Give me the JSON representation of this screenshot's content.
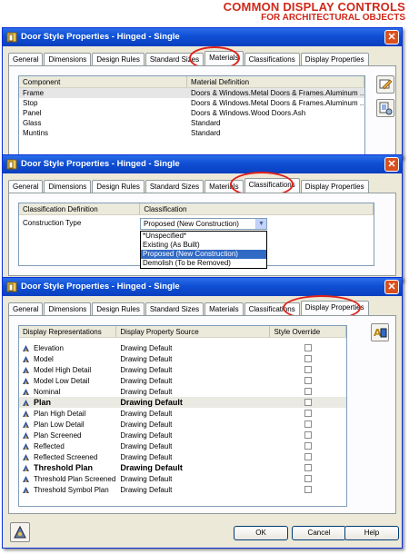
{
  "banner": {
    "title": "COMMON DISPLAY CONTROLS",
    "subtitle": "FOR ARCHITECTURAL OBJECTS"
  },
  "window_title": "Door Style Properties - Hinged - Single",
  "tabs": [
    "General",
    "Dimensions",
    "Design Rules",
    "Standard Sizes",
    "Materials",
    "Classifications",
    "Display Properties"
  ],
  "materials": {
    "headers": [
      "Component",
      "Material Definition"
    ],
    "rows": [
      {
        "component": "Frame",
        "material": "Doors & Windows.Metal Doors & Frames.Aluminum ..."
      },
      {
        "component": "Stop",
        "material": "Doors & Windows.Metal Doors & Frames.Aluminum ..."
      },
      {
        "component": "Panel",
        "material": "Doors & Windows.Wood Doors.Ash"
      },
      {
        "component": "Glass",
        "material": "Standard"
      },
      {
        "component": "Muntins",
        "material": "Standard"
      }
    ]
  },
  "classifications": {
    "headers": [
      "Classification Definition",
      "Classification"
    ],
    "row_label": "Construction Type",
    "selected_value": "Proposed (New Construction)",
    "options": [
      "*Unspecified*",
      "Existing (As Built)",
      "Proposed (New Construction)",
      "Demolish (To be Removed)"
    ]
  },
  "display_properties": {
    "headers": [
      "Display Representations",
      "Display Property Source",
      "Style Override"
    ],
    "rows": [
      {
        "name": "Elevation",
        "source": "Drawing Default",
        "bold": false
      },
      {
        "name": "Model",
        "source": "Drawing Default",
        "bold": false
      },
      {
        "name": "Model High Detail",
        "source": "Drawing Default",
        "bold": false
      },
      {
        "name": "Model Low Detail",
        "source": "Drawing Default",
        "bold": false
      },
      {
        "name": "Nominal",
        "source": "Drawing Default",
        "bold": false
      },
      {
        "name": "Plan",
        "source": "Drawing Default",
        "bold": true
      },
      {
        "name": "Plan High Detail",
        "source": "Drawing Default",
        "bold": false
      },
      {
        "name": "Plan Low Detail",
        "source": "Drawing Default",
        "bold": false
      },
      {
        "name": "Plan Screened",
        "source": "Drawing Default",
        "bold": false
      },
      {
        "name": "Reflected",
        "source": "Drawing Default",
        "bold": false
      },
      {
        "name": "Reflected Screened",
        "source": "Drawing Default",
        "bold": false
      },
      {
        "name": "Threshold Plan",
        "source": "Drawing Default",
        "bold": true
      },
      {
        "name": "Threshold Plan Screened",
        "source": "Drawing Default",
        "bold": false
      },
      {
        "name": "Threshold Symbol Plan",
        "source": "Drawing Default",
        "bold": false
      }
    ]
  },
  "buttons": {
    "ok": "OK",
    "cancel": "Cancel",
    "help": "Help"
  },
  "colors": {
    "title_bar": "#0f4fd4",
    "highlight_ring": "#e0201a",
    "banner": "#d0281a",
    "selection": "#316ac5"
  }
}
